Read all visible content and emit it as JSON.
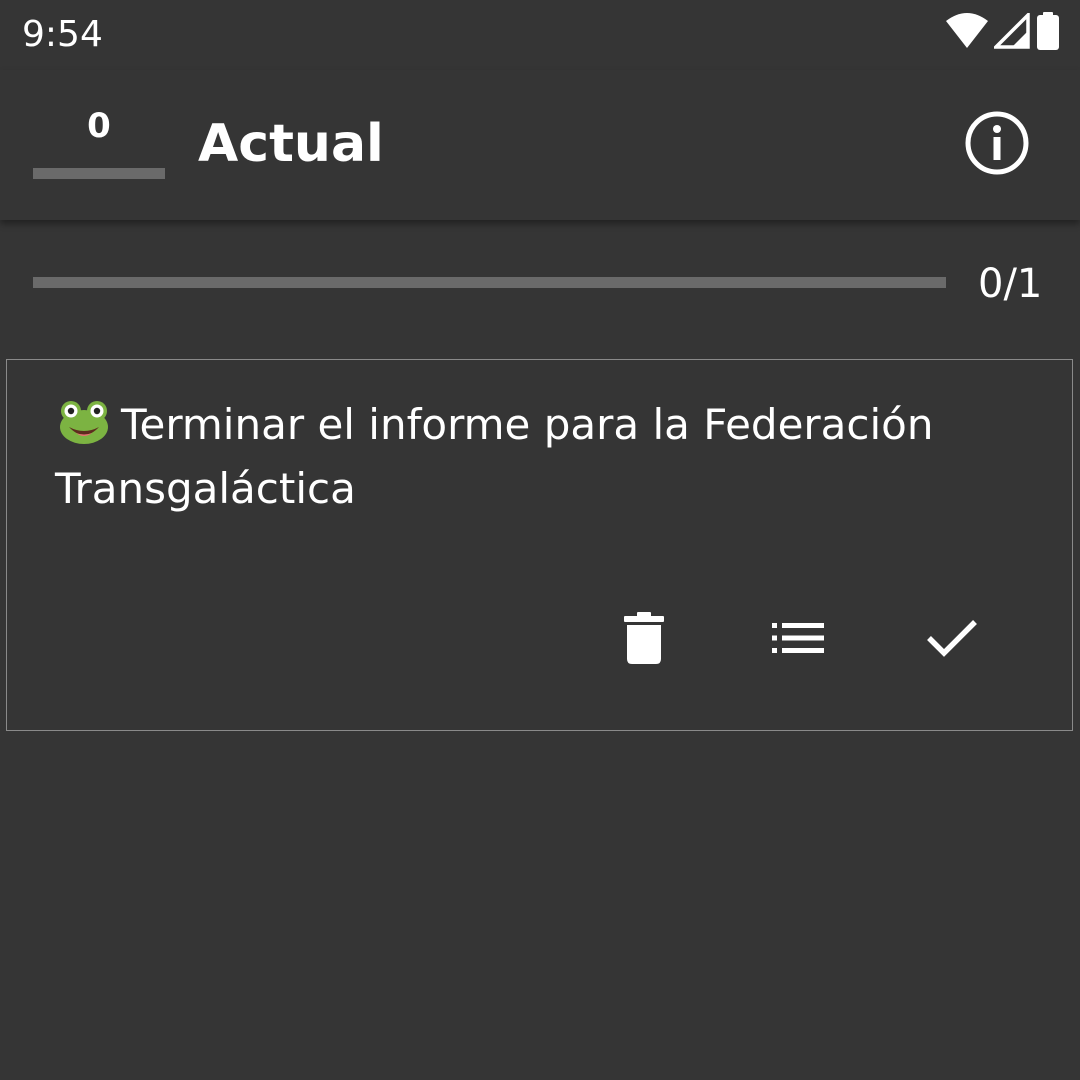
{
  "status_bar": {
    "time": "9:54"
  },
  "app_bar": {
    "counter_value": "0",
    "title": "Actual"
  },
  "progress": {
    "done": 0,
    "total": 1,
    "label": "0/1"
  },
  "tasks": [
    {
      "emoji": "frog",
      "text": "Terminar el informe para la Federación Transgaláctica"
    }
  ],
  "icons": {
    "status": [
      "wifi-icon",
      "cell-signal-icon",
      "battery-icon"
    ],
    "app_bar": "info-icon",
    "task_actions": [
      "delete-icon",
      "list-icon",
      "check-icon"
    ]
  },
  "colors": {
    "background": "#353535",
    "underline_gray": "#6a6a6a",
    "text": "#ffffff",
    "card_border": "#8a8a8a"
  }
}
